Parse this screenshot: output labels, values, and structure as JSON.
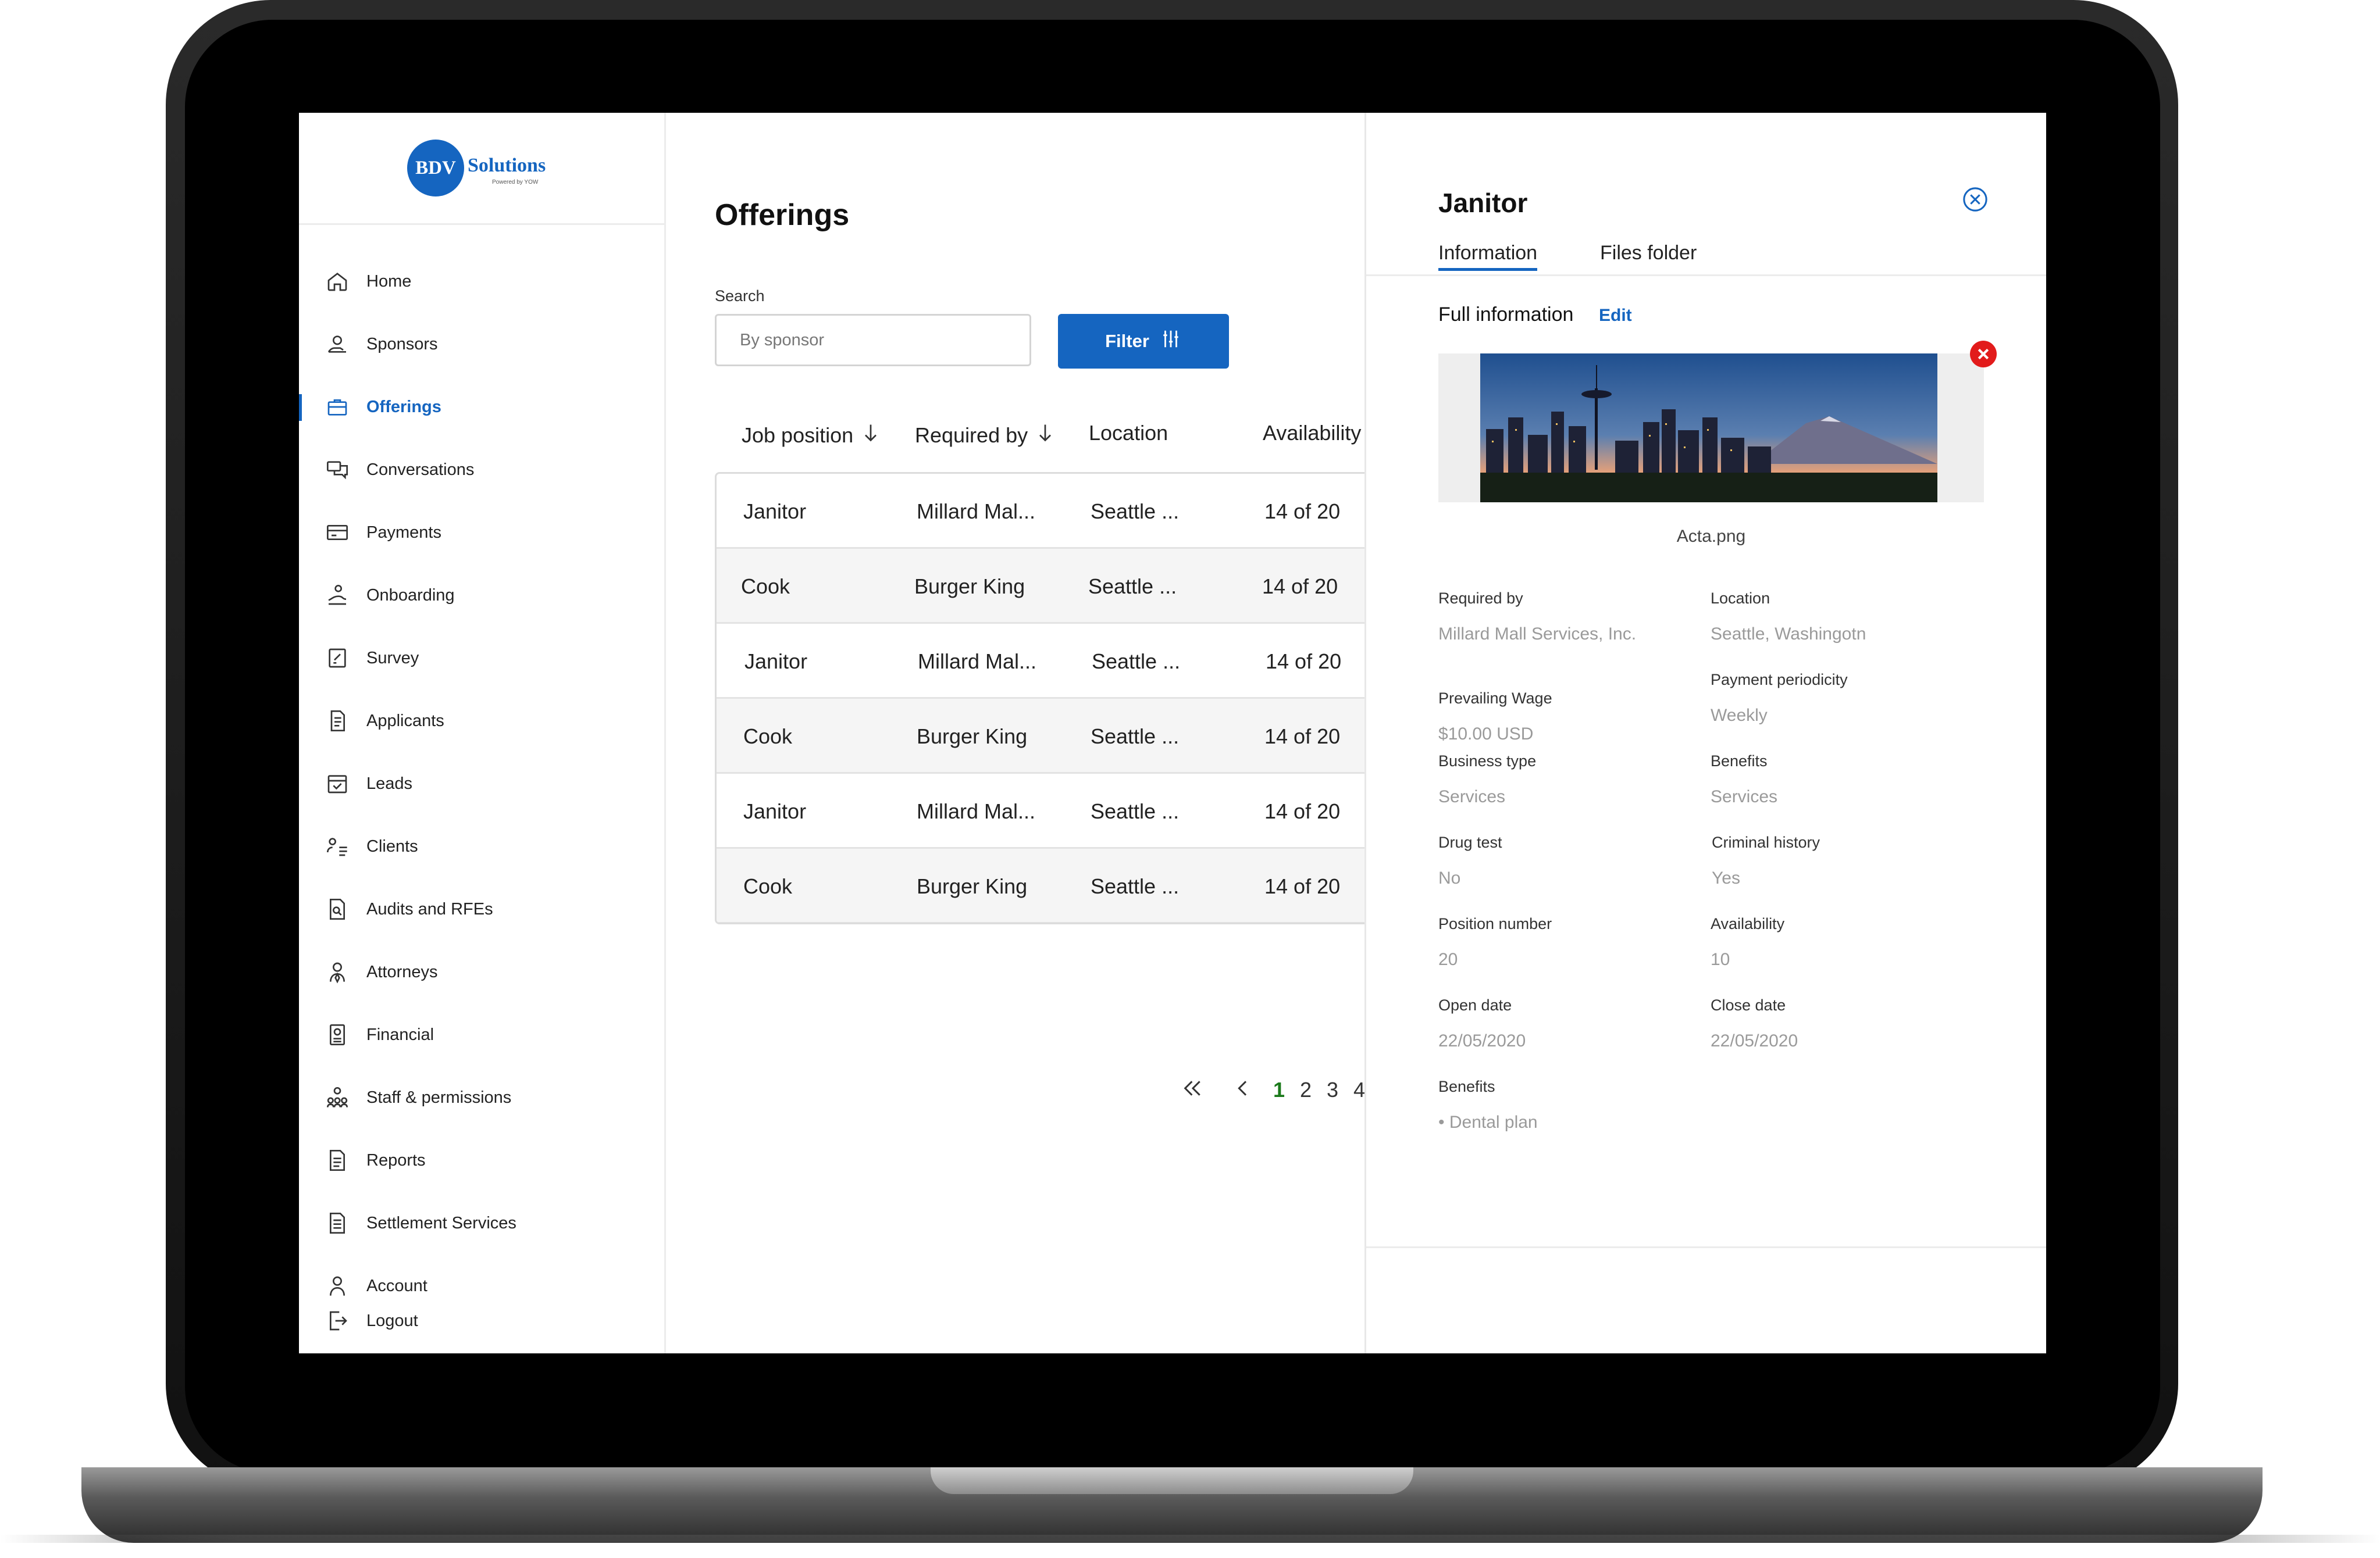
{
  "brand": {
    "logo_mark": "BDV",
    "logo_word": "Solutions",
    "logo_tagline": "Powered by YOW"
  },
  "sidebar": {
    "items": [
      {
        "label": "Home",
        "icon": "home-icon"
      },
      {
        "label": "Sponsors",
        "icon": "sponsors-icon"
      },
      {
        "label": "Offerings",
        "icon": "briefcase-icon",
        "active": true
      },
      {
        "label": "Conversations",
        "icon": "chat-icon"
      },
      {
        "label": "Payments",
        "icon": "card-icon"
      },
      {
        "label": "Onboarding",
        "icon": "onboarding-icon"
      },
      {
        "label": "Survey",
        "icon": "survey-icon"
      },
      {
        "label": "Applicants",
        "icon": "document-icon"
      },
      {
        "label": "Leads",
        "icon": "leads-icon"
      },
      {
        "label": "Clients",
        "icon": "clients-icon"
      },
      {
        "label": "Audits and RFEs",
        "icon": "audit-icon"
      },
      {
        "label": "Attorneys",
        "icon": "attorney-icon"
      },
      {
        "label": "Financial",
        "icon": "financial-icon"
      },
      {
        "label": "Staff & permissions",
        "icon": "staff-icon"
      },
      {
        "label": "Reports",
        "icon": "reports-icon"
      },
      {
        "label": "Settlement Services",
        "icon": "settlement-icon"
      },
      {
        "label": "Account",
        "icon": "user-icon"
      },
      {
        "label": "Logout",
        "icon": "logout-icon"
      }
    ]
  },
  "main": {
    "title": "Offerings",
    "search_label": "Search",
    "search_placeholder": "By sponsor",
    "filter_label": "Filter",
    "columns": [
      "Job position",
      "Required by",
      "Location",
      "Availability"
    ],
    "rows": [
      {
        "position": "Janitor",
        "required_by": "Millard Mal...",
        "location": "Seattle ...",
        "availability": "14 of 20"
      },
      {
        "position": "Cook",
        "required_by": "Burger King",
        "location": "Seattle ...",
        "availability": "14 of 20"
      },
      {
        "position": "Janitor",
        "required_by": "Millard Mal...",
        "location": "Seattle ...",
        "availability": "14 of 20"
      },
      {
        "position": "Cook",
        "required_by": "Burger King",
        "location": "Seattle ...",
        "availability": "14 of 20"
      },
      {
        "position": "Janitor",
        "required_by": "Millard Mal...",
        "location": "Seattle ...",
        "availability": "14 of 20"
      },
      {
        "position": "Cook",
        "required_by": "Burger King",
        "location": "Seattle ...",
        "availability": "14 of 20"
      }
    ],
    "pagination": {
      "pages": [
        "1",
        "2",
        "3",
        "4"
      ],
      "current": "1"
    }
  },
  "panel": {
    "title": "Janitor",
    "tabs": [
      "Information",
      "Files folder"
    ],
    "section_label": "Full information",
    "edit_label": "Edit",
    "file_name": "Acta.png",
    "fields": {
      "required_by": {
        "label": "Required by",
        "value": "Millard Mall Services, Inc."
      },
      "location": {
        "label": "Location",
        "value": "Seattle, Washingotn"
      },
      "prevailing_wage": {
        "label": "Prevailing Wage",
        "value": "$10.00 USD"
      },
      "payment_periodicity": {
        "label": "Payment periodicity",
        "value": "Weekly"
      },
      "business_type": {
        "label": "Business type",
        "value": "Services"
      },
      "benefits_top": {
        "label": "Benefits",
        "value": "Services"
      },
      "drug_test": {
        "label": "Drug test",
        "value": "No"
      },
      "criminal_history": {
        "label": "Criminal history",
        "value": "Yes"
      },
      "position_number": {
        "label": "Position number",
        "value": "20"
      },
      "availability": {
        "label": "Availability",
        "value": "10"
      },
      "open_date": {
        "label": "Open date",
        "value": "22/05/2020"
      },
      "close_date": {
        "label": "Close date",
        "value": "22/05/2020"
      },
      "benefits_list": {
        "label": "Benefits",
        "value": "• Dental plan"
      }
    }
  },
  "colors": {
    "accent": "#1565c0",
    "active_page": "#1b7a1b",
    "danger": "#e21b1b"
  }
}
